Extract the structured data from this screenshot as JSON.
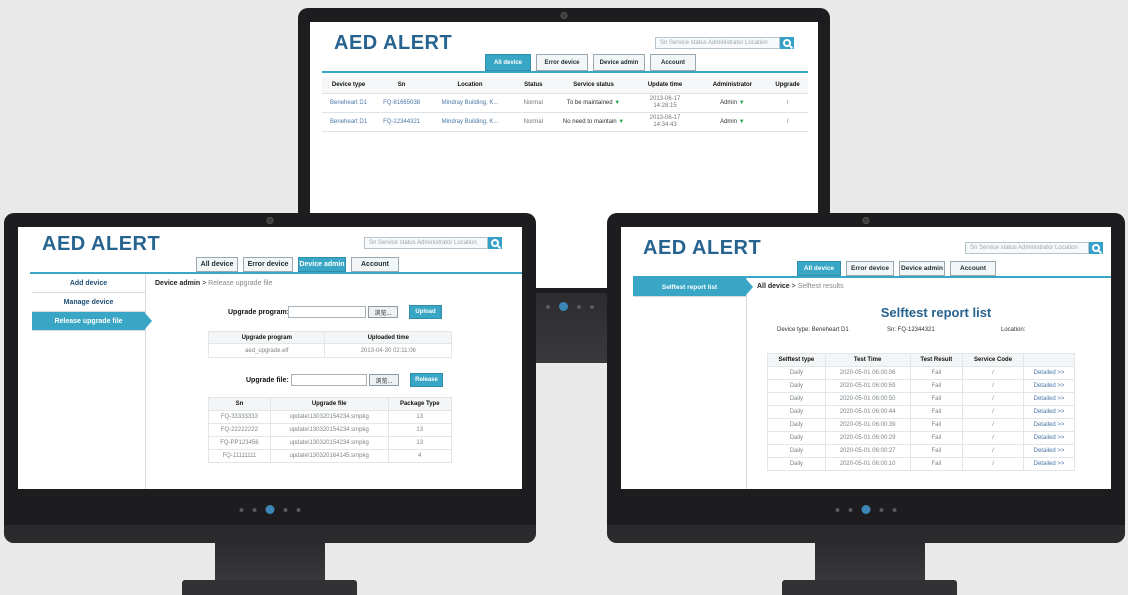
{
  "top": {
    "logo": "AED ALERT",
    "search_placeholder": "Sn Service status Administrator Location",
    "tabs": [
      "All device",
      "Error device",
      "Device admin",
      "Account"
    ],
    "active_tab": 0,
    "headers": [
      "Device type",
      "Sn",
      "Location",
      "Status",
      "Service status",
      "Update time",
      "Administrator",
      "Upgrade"
    ],
    "rows": [
      [
        "Beneheart D1",
        "FQ-81665038",
        "Mindray Building, K...",
        "Normal",
        "To be maintained",
        "2013-06-17 14:28:15",
        "Admin",
        "/"
      ],
      [
        "Beneheart D1",
        "FQ-12344321",
        "Mindray Building, K...",
        "Normal",
        "No need to maintain",
        "2013-06-17 14:34:43",
        "Admin",
        "/"
      ]
    ]
  },
  "left": {
    "logo": "AED ALERT",
    "search_placeholder": "Sn Service status Administrator Location",
    "tabs": [
      "All device",
      "Error device",
      "Device admin",
      "Account"
    ],
    "active_tab": 2,
    "sidebar": [
      "Add device",
      "Manage device",
      "Release upgrade file"
    ],
    "active_side": 2,
    "breadcrumb_main": "Device admin",
    "breadcrumb_sep": ">",
    "breadcrumb_sub": "Release upgrade file",
    "program_label": "Upgrade program:",
    "browse_label": "浏览...",
    "upload_label": "Upload",
    "program_table": {
      "headers": [
        "Upgrade program",
        "Uploaded time"
      ],
      "rows": [
        [
          "aed_upgrade.elf",
          "2013-04-30 02:11:06"
        ]
      ]
    },
    "file_label": "Upgrade file:",
    "release_label": "Release",
    "file_table": {
      "headers": [
        "Sn",
        "Upgrade file",
        "Package Type"
      ],
      "rows": [
        [
          "FQ-33333333",
          "update\\130320154234.smpkg",
          "13"
        ],
        [
          "FQ-22222222",
          "update\\130320154234.smpkg",
          "13"
        ],
        [
          "FQ-PP123456",
          "update\\130320154234.smpkg",
          "13"
        ],
        [
          "FQ-11111111",
          "update\\130320164145.smpkg",
          "4"
        ]
      ]
    }
  },
  "right": {
    "logo": "AED ALERT",
    "search_placeholder": "Sn Service status Administrator Location",
    "tabs": [
      "All device",
      "Error device",
      "Device admin",
      "Account"
    ],
    "active_tab": 0,
    "sidebar": [
      "Selftest report list"
    ],
    "breadcrumb_main": "All device",
    "breadcrumb_sep": ">",
    "breadcrumb_sub": "Selftest results",
    "title": "Selftest report list",
    "info": {
      "device_type": "Device type: Beneheart D1",
      "sn": "Sn: FQ-12344321",
      "location": "Location:"
    },
    "headers": [
      "Selftest type",
      "Test Time",
      "Test Result",
      "Service Code",
      ""
    ],
    "rows": [
      [
        "Daily",
        "2020-05-01 06:00:06",
        "Fail",
        "/",
        "Detailed >>"
      ],
      [
        "Daily",
        "2020-05-01 06:00:59",
        "Fail",
        "/",
        "Detailed >>"
      ],
      [
        "Daily",
        "2020-05-01 06:00:50",
        "Fail",
        "/",
        "Detailed >>"
      ],
      [
        "Daily",
        "2020-05-01 06:00:44",
        "Fail",
        "/",
        "Detailed >>"
      ],
      [
        "Daily",
        "2020-05-01 06:00:39",
        "Fail",
        "/",
        "Detailed >>"
      ],
      [
        "Daily",
        "2020-05-01 06:00:29",
        "Fail",
        "/",
        "Detailed >>"
      ],
      [
        "Daily",
        "2020-05-01 06:00:27",
        "Fail",
        "/",
        "Detailed >>"
      ],
      [
        "Daily",
        "2020-05-01 06:00:10",
        "Fail",
        "/",
        "Detailed >>"
      ]
    ]
  },
  "colors": {
    "brand": "#27638f",
    "accent": "#3aa6c5",
    "chin_dot_active": "#3c86b8"
  }
}
